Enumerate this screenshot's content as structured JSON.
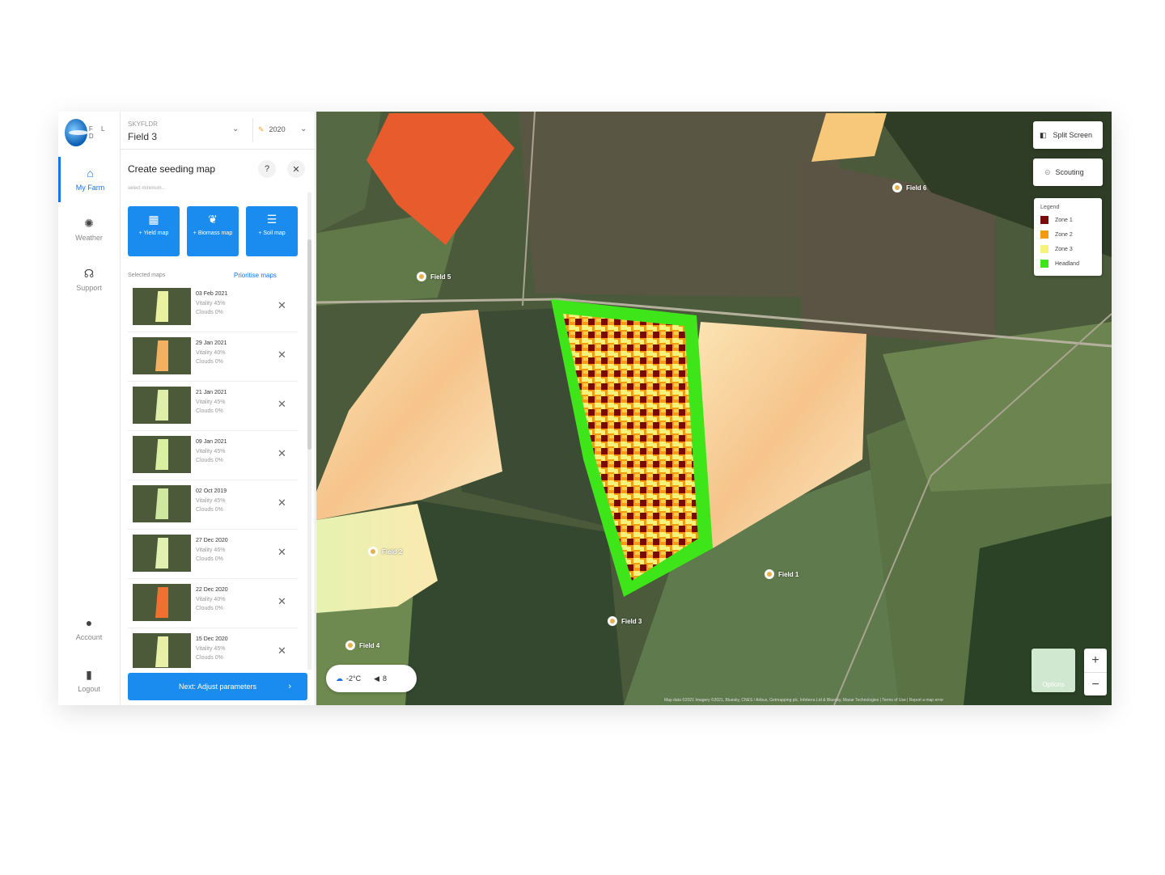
{
  "nav": {
    "logo_text": "F L D",
    "items": [
      {
        "label": "My Farm",
        "icon": "home-icon"
      },
      {
        "label": "Weather",
        "icon": "sun-icon"
      },
      {
        "label": "Support",
        "icon": "headset-icon"
      },
      {
        "label": "Account",
        "icon": "user-icon"
      },
      {
        "label": "Logout",
        "icon": "logout-icon"
      }
    ]
  },
  "field_selector": {
    "label": "SKYFLDR",
    "field": "Field 3",
    "year": "2020"
  },
  "panel": {
    "title": "Create seeding map",
    "subtitle": "select minimum...",
    "add_buttons": [
      {
        "label": "+ Yield map"
      },
      {
        "label": "+ Biomass map"
      },
      {
        "label": "+ Soil map"
      }
    ],
    "selected_label": "Selected maps",
    "prioritise_label": "Prioritise maps",
    "maps": [
      {
        "date": "03 Feb 2021",
        "vitality": "Vitality 45%",
        "clouds": "Clouds 0%",
        "tone": "#e9f0a0"
      },
      {
        "date": "29 Jan 2021",
        "vitality": "Vitality 40%",
        "clouds": "Clouds 0%",
        "tone": "#f2b060"
      },
      {
        "date": "21 Jan 2021",
        "vitality": "Vitality 45%",
        "clouds": "Clouds 0%",
        "tone": "#dfeea8"
      },
      {
        "date": "09 Jan 2021",
        "vitality": "Vitality 45%",
        "clouds": "Clouds 0%",
        "tone": "#d8f0a0"
      },
      {
        "date": "02 Oct 2019",
        "vitality": "Vitality 45%",
        "clouds": "Clouds 0%",
        "tone": "#cfe8a0"
      },
      {
        "date": "27 Dec 2020",
        "vitality": "Vitality 46%",
        "clouds": "Clouds 0%",
        "tone": "#e2f0b0"
      },
      {
        "date": "22 Dec 2020",
        "vitality": "Vitality 40%",
        "clouds": "Clouds 0%",
        "tone": "#f07030"
      },
      {
        "date": "15 Dec 2020",
        "vitality": "Vitality 45%",
        "clouds": "Clouds 0%",
        "tone": "#e8f0a8"
      }
    ],
    "next_label": "Next: Adjust parameters"
  },
  "map": {
    "split_screen": "Split Screen",
    "scouting": "Scouting",
    "legend_title": "Legend",
    "legend": [
      {
        "label": "Zone 1",
        "color": "#7a0a0a"
      },
      {
        "label": "Zone 2",
        "color": "#f39c12"
      },
      {
        "label": "Zone 3",
        "color": "#f7f37a"
      },
      {
        "label": "Headland",
        "color": "#3ee619"
      }
    ],
    "field_labels": [
      "Field 6",
      "Field 5",
      "Field 1",
      "Field 2",
      "Field 3",
      "Field 4"
    ],
    "weather_temp": "-2°C",
    "wind": "8",
    "options": "Options",
    "zoom_in": "+",
    "zoom_out": "−",
    "attribution": "Map data ©2021 Imagery ©2021, Bluesky, CNES / Airbus, Getmapping plc, Infoterra Ltd & Bluesky, Maxar Technologies  |  Terms of Use  |  Report a map error"
  },
  "colors": {
    "accent": "#1a8cf0"
  }
}
